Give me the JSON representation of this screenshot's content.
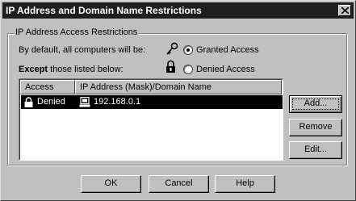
{
  "window": {
    "title": "IP Address and Domain Name Restrictions"
  },
  "group": {
    "legend": "IP Address Access Restrictions"
  },
  "default_text": "By default, all computers will be:",
  "except_bold": "Except",
  "except_rest": " those listed below:",
  "radios": {
    "granted": {
      "label": "Granted Access",
      "selected": true
    },
    "denied": {
      "label": "Denied Access",
      "selected": false
    }
  },
  "list": {
    "columns": [
      "Access",
      "IP Address (Mask)/Domain Name"
    ],
    "rows": [
      {
        "access": "Denied",
        "address": "192.168.0.1"
      }
    ]
  },
  "buttons": {
    "add": "Add...",
    "remove": "Remove",
    "edit": "Edit...",
    "ok": "OK",
    "cancel": "Cancel",
    "help": "Help"
  },
  "icons": [
    "close-icon",
    "key-icon",
    "padlock-icon",
    "computer-icon"
  ]
}
